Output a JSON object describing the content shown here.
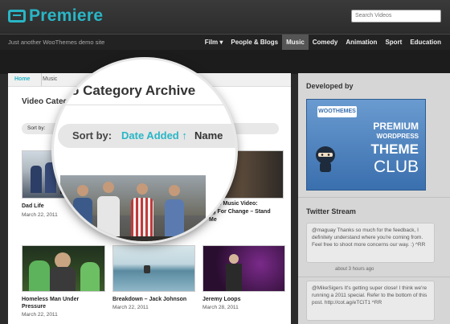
{
  "header": {
    "logo_text": "Premiere",
    "search_placeholder": "Search Videos",
    "tagline": "Just another WooThemes demo site",
    "nav": [
      {
        "label": "Film ▾"
      },
      {
        "label": "People & Blogs"
      },
      {
        "label": "Music",
        "active": true
      },
      {
        "label": "Comedy"
      },
      {
        "label": "Animation"
      },
      {
        "label": "Sport"
      },
      {
        "label": "Education"
      }
    ]
  },
  "breadcrumb": {
    "home": "Home",
    "current": "Music"
  },
  "main": {
    "title": "Video Catego",
    "sort_label": "Sort by:",
    "items": [
      {
        "title": "Dad Life",
        "date": "March 22, 2011"
      },
      {
        "title": "2009 Music Video:",
        "title2": "ng For Change – Stand",
        "title3": "Me",
        "date": "March 22, 2011"
      },
      {
        "title": "Homeless Man Under",
        "title2": "Pressure",
        "date": "March 22, 2011"
      },
      {
        "title": "Breakdown – Jack Johnson",
        "date": "March 22, 2011"
      },
      {
        "title": "Jeremy Loops",
        "date": "March 28, 2011"
      }
    ]
  },
  "magnifier": {
    "title": "o Category Archive",
    "sort_by": "Sort by:",
    "date_added": "Date Added ↑",
    "name": "Name"
  },
  "sidebar": {
    "developed_by": "Developed by",
    "ad": {
      "woo": "WOOTHEMES",
      "line1": "PREMIUM",
      "line2": "WORDPRESS",
      "line3": "THEME",
      "line4": "CLUB"
    },
    "twitter_title": "Twitter Stream",
    "tweets": [
      {
        "text": "@maguay Thanks so much for the feedback, I definitely understand where you're coming from. Feel free to shoot more concerns our way. :) ^RR",
        "time": "about 3 hours ago"
      },
      {
        "text": "@MikeSigers It's getting super close! I think we're running a 2011 special. Refer to the bottom of this post. http://cot.ag/eTCiT1 ^RR",
        "time": ""
      }
    ]
  },
  "colors": {
    "accent": "#29b6c6"
  }
}
